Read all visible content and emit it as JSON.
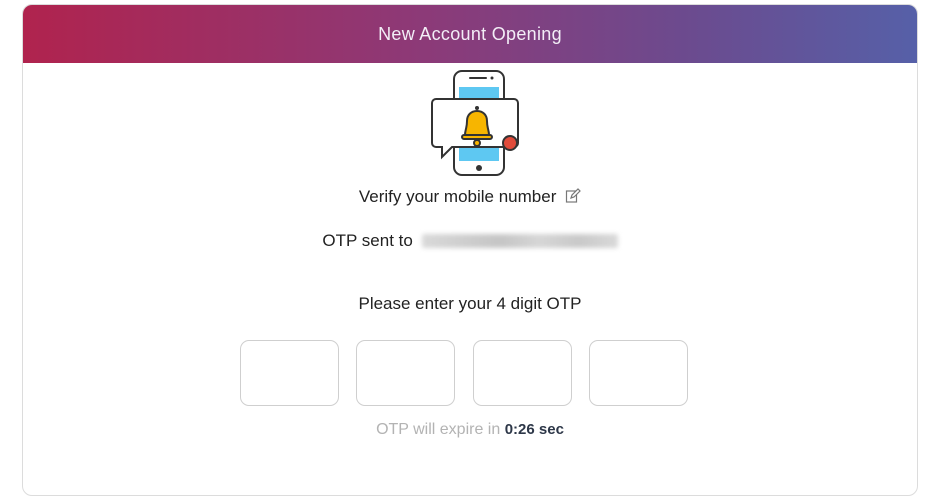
{
  "header": {
    "title": "New Account Opening"
  },
  "icons": {
    "illustration": "phone-notification-bell-icon",
    "edit": "edit-icon"
  },
  "verify": {
    "label": "Verify your mobile number"
  },
  "otp_sent": {
    "label": "OTP sent to"
  },
  "prompt": {
    "label": "Please enter your 4 digit OTP"
  },
  "otp_inputs": [
    "",
    "",
    "",
    ""
  ],
  "timer": {
    "prefix": "OTP will expire in",
    "value": "0:26 sec"
  },
  "colors": {
    "header_gradient_start": "#b0234e",
    "header_gradient_end": "#5660a8",
    "phone_screen": "#5ec8f2",
    "bell": "#f7b500",
    "notification_dot": "#e04b3a"
  }
}
